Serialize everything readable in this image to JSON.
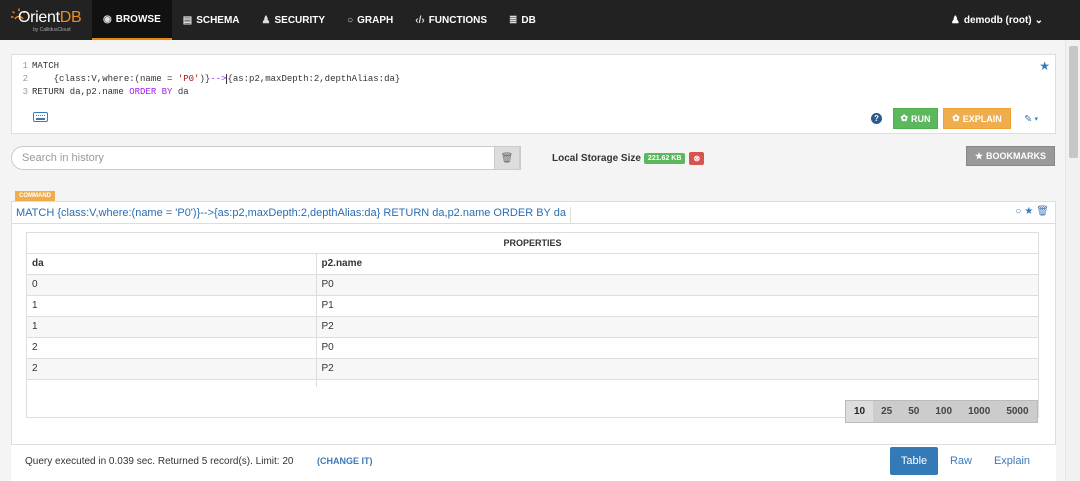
{
  "nav": {
    "brand": "Orient",
    "brand_db": "DB",
    "brand_sub": "by CallidusCloud",
    "items": [
      {
        "label": "BROWSE",
        "icon": "eye-icon",
        "glyph": "◉"
      },
      {
        "label": "SCHEMA",
        "icon": "table-icon",
        "glyph": "▤"
      },
      {
        "label": "SECURITY",
        "icon": "user-icon",
        "glyph": "♟"
      },
      {
        "label": "GRAPH",
        "icon": "circle-icon",
        "glyph": "○"
      },
      {
        "label": "FUNCTIONS",
        "icon": "code-icon",
        "glyph": "‹/›"
      },
      {
        "label": "DB",
        "icon": "database-icon",
        "glyph": "≣"
      }
    ],
    "user": "demodb (root)",
    "user_glyph": "♟",
    "caret": "⌄"
  },
  "editor": {
    "line_numbers": [
      "1",
      "2",
      "3"
    ],
    "line1": "MATCH",
    "line2_a": "    {class:V,where:(name = ",
    "line2_str": "'P0'",
    "line2_b": ")}",
    "line2_op": "-->",
    "line2_c": "{as:p2,maxDepth:2,depthAlias:da}",
    "line3_a": "RETURN da,p2.name ",
    "line3_b": "ORDER BY",
    "line3_c": " da"
  },
  "actions": {
    "help_glyph": "?",
    "run": "RUN",
    "run_glyph": "✿",
    "explain": "EXPLAIN",
    "explain_glyph": "✿",
    "wrench": "✎",
    "caret": "▾",
    "star": "★"
  },
  "history": {
    "placeholder": "Search in history",
    "trash": "🗑"
  },
  "storage": {
    "label": "Local Storage Size",
    "size": "221.62 KB",
    "clear": "⊗"
  },
  "bookmarks": {
    "label": "BOOKMARKS",
    "glyph": "★"
  },
  "command": {
    "tag": "COMMAND",
    "text": "MATCH {class:V,where:(name = 'P0')}-->{as:p2,maxDepth:2,depthAlias:da} RETURN da,p2.name ORDER BY da",
    "icons": [
      "○",
      "★",
      "🗑"
    ]
  },
  "result": {
    "group_header": "PROPERTIES",
    "columns": [
      "da",
      "p2.name"
    ],
    "rows": [
      [
        "0",
        "P0"
      ],
      [
        "1",
        "P1"
      ],
      [
        "1",
        "P2"
      ],
      [
        "2",
        "P0"
      ],
      [
        "2",
        "P2"
      ]
    ],
    "page_sizes": [
      "10",
      "25",
      "50",
      "100",
      "1000",
      "5000"
    ],
    "selected_page_size": "10"
  },
  "footer": {
    "info": "Query executed in 0.039 sec. Returned 5 record(s). Limit: 20",
    "change": "(CHANGE IT)",
    "tabs": [
      "Table",
      "Raw",
      "Explain"
    ],
    "active_tab": "Table"
  }
}
